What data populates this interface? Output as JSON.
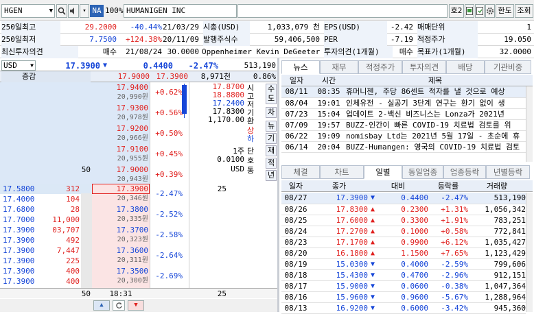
{
  "toolbar": {
    "symbol": "HGEN",
    "market_badge": "NA",
    "ratio": "100%",
    "company": "HUMANIGEN INC",
    "screen_no": "호2",
    "limit_button": "한도",
    "query_button": "조회"
  },
  "info": {
    "r1": {
      "l1": "250일최고",
      "v1": "29.2000",
      "p1": "-40.44%",
      "d1": "21/03/29",
      "l2": "시총(USD)",
      "v2": "1,033,079 천",
      "l3": "EPS(USD)",
      "v3": "-2.42",
      "l4": "매매단위",
      "v4": "1"
    },
    "r2": {
      "l1": "250일최저",
      "v1": "7.7500",
      "p1": "+124.38%",
      "d1": "20/11/09",
      "l2": "발행주식수",
      "v2": "59,406,500",
      "l3": "PER",
      "v3": "-7.19",
      "l4": "적정주가",
      "v4": "19.050"
    },
    "r3": {
      "l1": "최신투자의견",
      "v1": "매수",
      "d1": "21/08/24",
      "v1b": "30.0000",
      "analyst": "Oppenheimer Kevin DeGeeter",
      "l3": "투자의견(1개월)",
      "v3": "매수",
      "l4": "목표가(1개월)",
      "v4": "32.0000"
    }
  },
  "pricebar": {
    "currency": "USD",
    "price": "17.3900",
    "change": "0.4400",
    "rate": "-2.47%",
    "volume": "513,190"
  },
  "summary": {
    "label": "증감",
    "ask_total": "17.9000",
    "bid_total": "17.3900",
    "volume": "8,971천",
    "rate": "0.86%"
  },
  "asks": [
    {
      "price": "17.9400",
      "krw": "20,990원",
      "rate": "+0.62%",
      "qty": ""
    },
    {
      "price": "17.9300",
      "krw": "20,978원",
      "rate": "+0.56%",
      "qty": ""
    },
    {
      "price": "17.9200",
      "krw": "20,966원",
      "rate": "+0.50%",
      "qty": ""
    },
    {
      "price": "17.9100",
      "krw": "20,955원",
      "rate": "+0.45%",
      "qty": ""
    },
    {
      "price": "17.9000",
      "krw": "20,943원",
      "rate": "+0.39%",
      "qty": "50"
    }
  ],
  "bids": [
    {
      "price": "17.3900",
      "krw": "20,346원",
      "rate": "-2.47%",
      "qty": "25"
    },
    {
      "price": "17.3800",
      "krw": "20,335원",
      "rate": "-2.52%",
      "qty": ""
    },
    {
      "price": "17.3700",
      "krw": "20,323원",
      "rate": "-2.58%",
      "qty": ""
    },
    {
      "price": "17.3600",
      "krw": "20,311원",
      "rate": "-2.64%",
      "qty": ""
    },
    {
      "price": "17.3500",
      "krw": "20,300원",
      "rate": "-2.69%",
      "qty": ""
    }
  ],
  "stats": {
    "open": "17.8700",
    "high": "18.8800",
    "low": "17.2400",
    "close": "17.8300",
    "volume": "1,170.00",
    "labels": [
      "시",
      "고",
      "저",
      "기",
      "환"
    ],
    "up_label": "상",
    "down_label": "하",
    "unit": "1주",
    "tick": "0.0100",
    "cur": "USD",
    "labels2": [
      "단",
      "호",
      "통"
    ]
  },
  "side_buttons": [
    "수",
    "도",
    "차",
    "뉴",
    "기",
    "재",
    "적",
    "년"
  ],
  "trades": [
    {
      "price": "17.5800",
      "qty": "312"
    },
    {
      "price": "17.4000",
      "qty": "104"
    },
    {
      "price": "17.6800",
      "qty": "28"
    },
    {
      "price": "17.7000",
      "qty": "11,000"
    },
    {
      "price": "17.3900",
      "qty": "03,707"
    },
    {
      "price": "17.3900",
      "qty": "492"
    },
    {
      "price": "17.3900",
      "qty": "7,447"
    },
    {
      "price": "17.3900",
      "qty": "225"
    },
    {
      "price": "17.3900",
      "qty": "400"
    },
    {
      "price": "17.3900",
      "qty": "400"
    }
  ],
  "obfoot": {
    "ask_qty": "50",
    "time": "18:31",
    "bid_qty": "25"
  },
  "news_tabs": [
    "뉴스",
    "재무",
    "적정주가",
    "투자의견",
    "배당",
    "기관비중"
  ],
  "news_headers": [
    "일자",
    "시간",
    "제목"
  ],
  "news": [
    {
      "date": "08/11",
      "time": "08:35",
      "title": "휴머니젠, 주당 86센트 적자를 낼 것으로 예상"
    },
    {
      "date": "08/04",
      "time": "19:01",
      "title": "인체유전 - 실공기 3단계 연구는 환기 없이 생"
    },
    {
      "date": "07/23",
      "time": "15:04",
      "title": "업데이트 2-백신 비즈니스는 Lonza가 2021년"
    },
    {
      "date": "07/09",
      "time": "19:57",
      "title": "BUZZ-인간이 빠른 COVID-19 치료법 검토를 위"
    },
    {
      "date": "06/22",
      "time": "19:09",
      "title": "nomisbay Ltd는 2021년 5월 17일 - 초순에 휴"
    },
    {
      "date": "06/14",
      "time": "20:04",
      "title": "BUZZ-Humangen: 영국의 COVID-19 치료법 검토"
    }
  ],
  "daily_tabs": [
    "체결",
    "차트",
    "일별",
    "동일업종",
    "업종등락",
    "년별등락"
  ],
  "daily_headers": [
    "일자",
    "종가",
    "대비",
    "등락률",
    "거래량"
  ],
  "daily": [
    {
      "date": "08/27",
      "close": "17.3900",
      "dir": "down",
      "diff": "0.4400",
      "rate": "-2.47%",
      "volume": "513,190"
    },
    {
      "date": "08/26",
      "close": "17.8300",
      "dir": "up",
      "diff": "0.2300",
      "rate": "+1.31%",
      "volume": "1,056,342"
    },
    {
      "date": "08/25",
      "close": "17.6000",
      "dir": "up",
      "diff": "0.3300",
      "rate": "+1.91%",
      "volume": "783,251"
    },
    {
      "date": "08/24",
      "close": "17.2700",
      "dir": "up",
      "diff": "0.1000",
      "rate": "+0.58%",
      "volume": "772,841"
    },
    {
      "date": "08/23",
      "close": "17.1700",
      "dir": "up",
      "diff": "0.9900",
      "rate": "+6.12%",
      "volume": "1,035,427"
    },
    {
      "date": "08/20",
      "close": "16.1800",
      "dir": "up",
      "diff": "1.1500",
      "rate": "+7.65%",
      "volume": "1,123,429"
    },
    {
      "date": "08/19",
      "close": "15.0300",
      "dir": "down",
      "diff": "0.4000",
      "rate": "-2.59%",
      "volume": "799,606"
    },
    {
      "date": "08/18",
      "close": "15.4300",
      "dir": "down",
      "diff": "0.4700",
      "rate": "-2.96%",
      "volume": "912,151"
    },
    {
      "date": "08/17",
      "close": "15.9000",
      "dir": "down",
      "diff": "0.0600",
      "rate": "-0.38%",
      "volume": "1,047,364"
    },
    {
      "date": "08/16",
      "close": "15.9600",
      "dir": "down",
      "diff": "0.9600",
      "rate": "-5.67%",
      "volume": "1,288,964"
    },
    {
      "date": "08/13",
      "close": "16.9200",
      "dir": "down",
      "diff": "0.6000",
      "rate": "-3.42%",
      "volume": "945,360"
    }
  ],
  "colors": {
    "up": "#e0201e",
    "down": "#1646d8",
    "ask_bg": "#dce8f7",
    "bid_bg": "#fbe4e4"
  }
}
